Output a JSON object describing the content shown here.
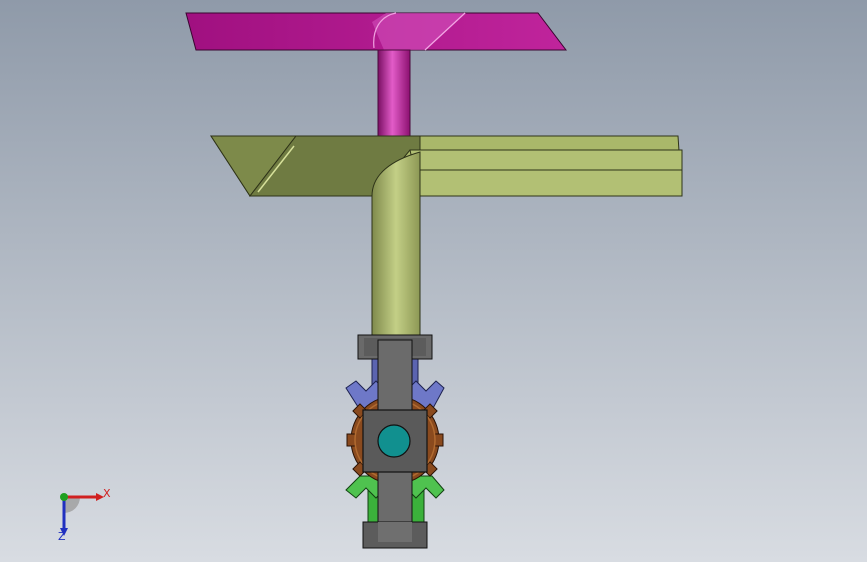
{
  "viewport": {
    "background_top": "#8f9aa9",
    "background_bottom": "#d8dce2"
  },
  "model": {
    "upper_blade_color": "#b4148f",
    "lower_blade_color": "#a9b86a",
    "gear_top_color": "#5b64b0",
    "gear_bottom_color": "#3bb13b",
    "crown_gear_color": "#8a4a1e",
    "bracket_color": "#5c5c5c",
    "hub_color": "#11908f"
  },
  "triad": {
    "x_label": "X",
    "z_label": "Z",
    "x_color": "#d02020",
    "y_color": "#20a020",
    "z_color": "#2030c0"
  }
}
